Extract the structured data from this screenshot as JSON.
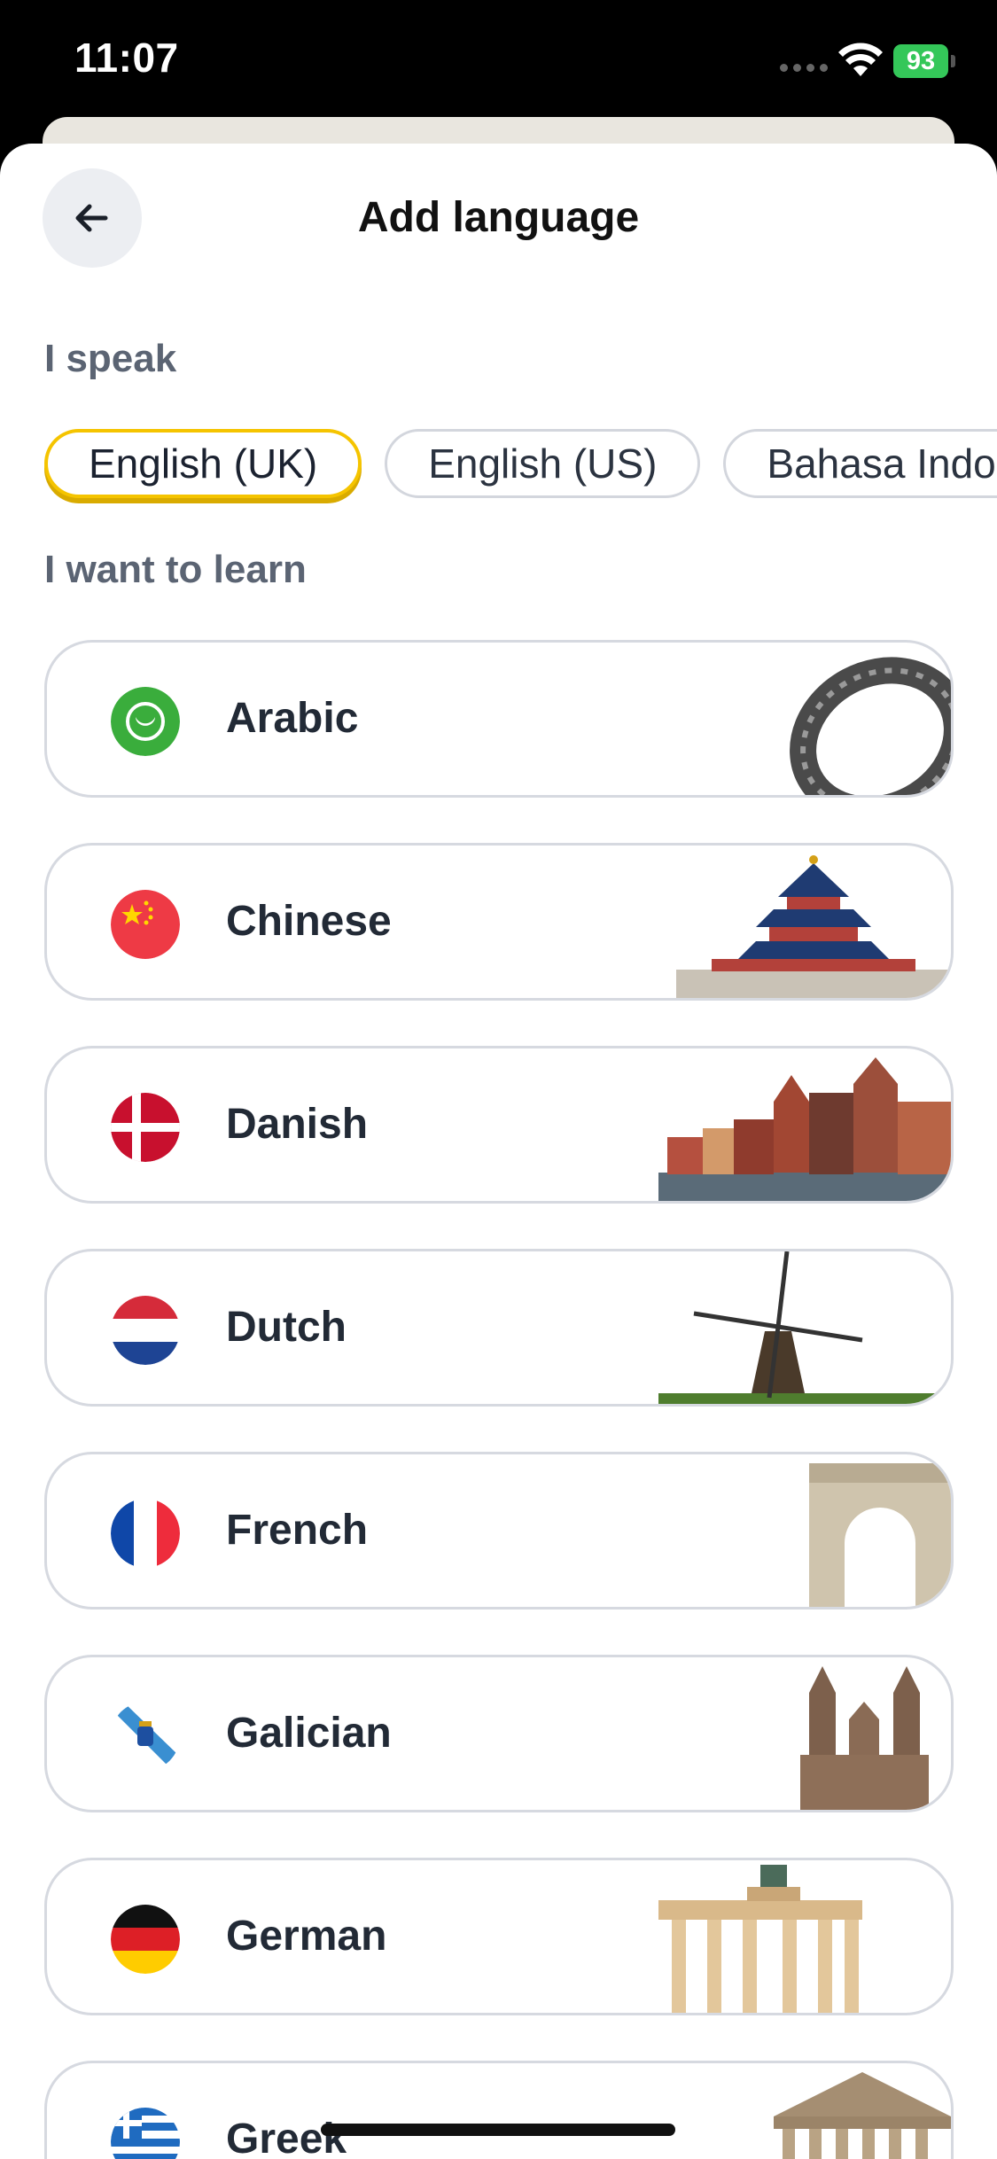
{
  "status_bar": {
    "time": "11:07",
    "battery": "93"
  },
  "header": {
    "title": "Add language"
  },
  "speak": {
    "label": "I speak",
    "chips": [
      "English (UK)",
      "English (US)",
      "Bahasa Indo"
    ],
    "selected": "English (UK)"
  },
  "learn": {
    "label": "I want to learn",
    "languages": [
      {
        "name": "Arabic"
      },
      {
        "name": "Chinese"
      },
      {
        "name": "Danish"
      },
      {
        "name": "Dutch"
      },
      {
        "name": "French"
      },
      {
        "name": "Galician"
      },
      {
        "name": "German"
      },
      {
        "name": "Greek"
      }
    ]
  },
  "colors": {
    "accent": "#f5c400",
    "muted_label": "#5b6473",
    "card_border": "#d6d9e0"
  }
}
